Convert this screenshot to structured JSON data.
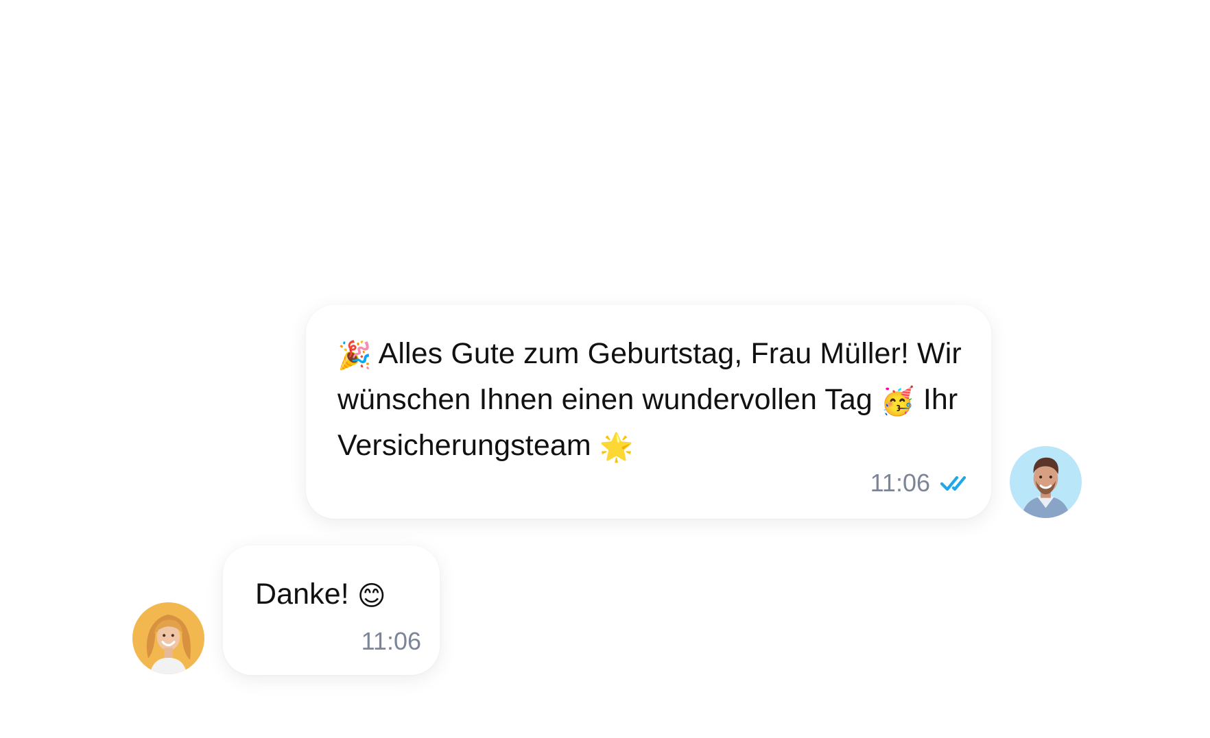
{
  "messages": [
    {
      "direction": "outgoing",
      "segments": [
        {
          "type": "emoji",
          "name": "party-popper",
          "text": "🎉"
        },
        {
          "type": "text",
          "text": " Alles Gute zum Geburtstag, Frau Müller! Wir wünschen Ihnen einen wundervollen Tag "
        },
        {
          "type": "emoji",
          "name": "party-face",
          "text": "🥳"
        },
        {
          "type": "text",
          "text": " Ihr Versicherungsteam "
        },
        {
          "type": "emoji",
          "name": "glowing-star",
          "text": "🌟"
        }
      ],
      "time": "11:06",
      "status": "read",
      "status_icon": "double-check-icon",
      "status_color": "#20a7e8",
      "avatar": "male-avatar"
    },
    {
      "direction": "incoming",
      "segments": [
        {
          "type": "text",
          "text": "Danke! "
        },
        {
          "type": "emoji",
          "name": "smiling-face",
          "text": "😊"
        }
      ],
      "time": "11:06",
      "avatar": "female-avatar"
    }
  ],
  "colors": {
    "background": "#ffffff",
    "timestamp": "#7b8596",
    "outgoing_avatar_bg": "#b9e6f8",
    "incoming_avatar_bg": "#f3b74f"
  }
}
